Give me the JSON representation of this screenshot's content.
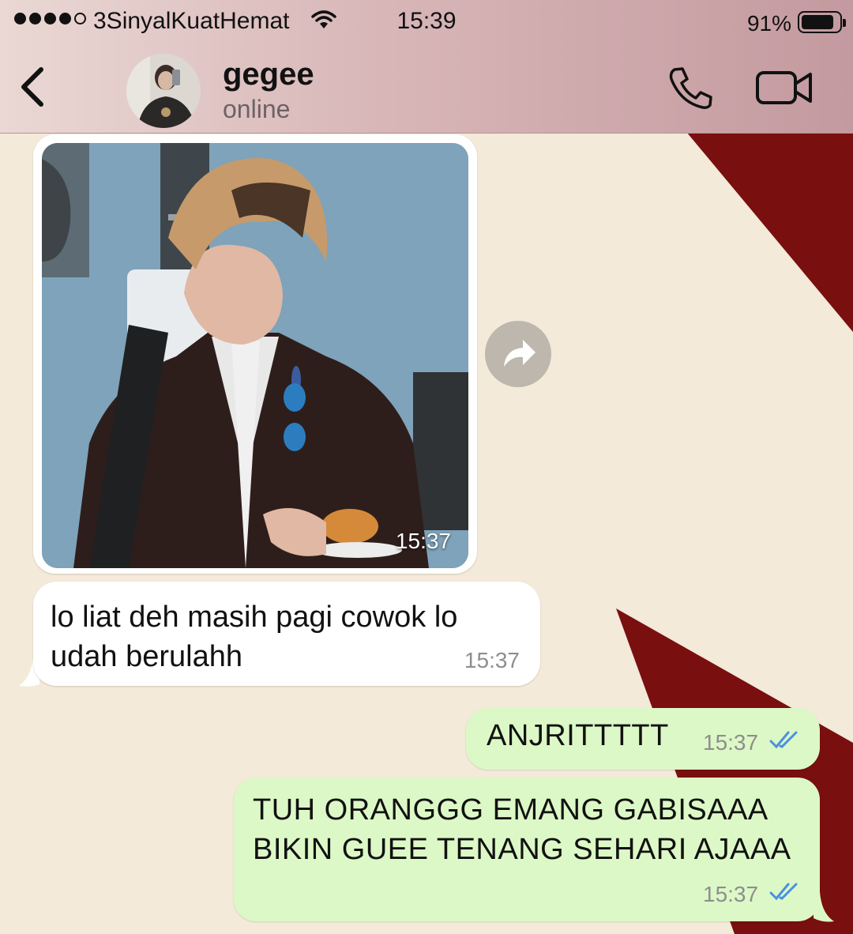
{
  "status_bar": {
    "carrier": "3SinyalKuatHemat",
    "time": "15:39",
    "battery_percent": "91%",
    "battery_level": 0.91,
    "signal_bars": 4
  },
  "header": {
    "contact_name": "gegee",
    "contact_status": "online",
    "back_icon": "chevron-left-icon",
    "call_icon": "phone-icon",
    "video_icon": "video-camera-icon"
  },
  "messages": [
    {
      "direction": "incoming",
      "type": "image",
      "time": "15:37"
    },
    {
      "direction": "incoming",
      "type": "text",
      "text": "lo liat deh masih pagi cowok lo udah berulahh",
      "time": "15:37"
    },
    {
      "direction": "outgoing",
      "type": "text",
      "text": "ANJRITTTTT",
      "time": "15:37",
      "status": "read"
    },
    {
      "direction": "outgoing",
      "type": "text",
      "text": "TUH ORANGGG EMANG GABISAAA BIKIN GUEE TENANG SEHARI AJAAA",
      "time": "15:37",
      "status": "read"
    }
  ],
  "colors": {
    "outgoing_bubble": "#dcf8c6",
    "incoming_bubble": "#ffffff",
    "read_ticks": "#4a90e2",
    "wallpaper_red": "#7a0f0f",
    "wallpaper_cream": "#f3ead9"
  }
}
